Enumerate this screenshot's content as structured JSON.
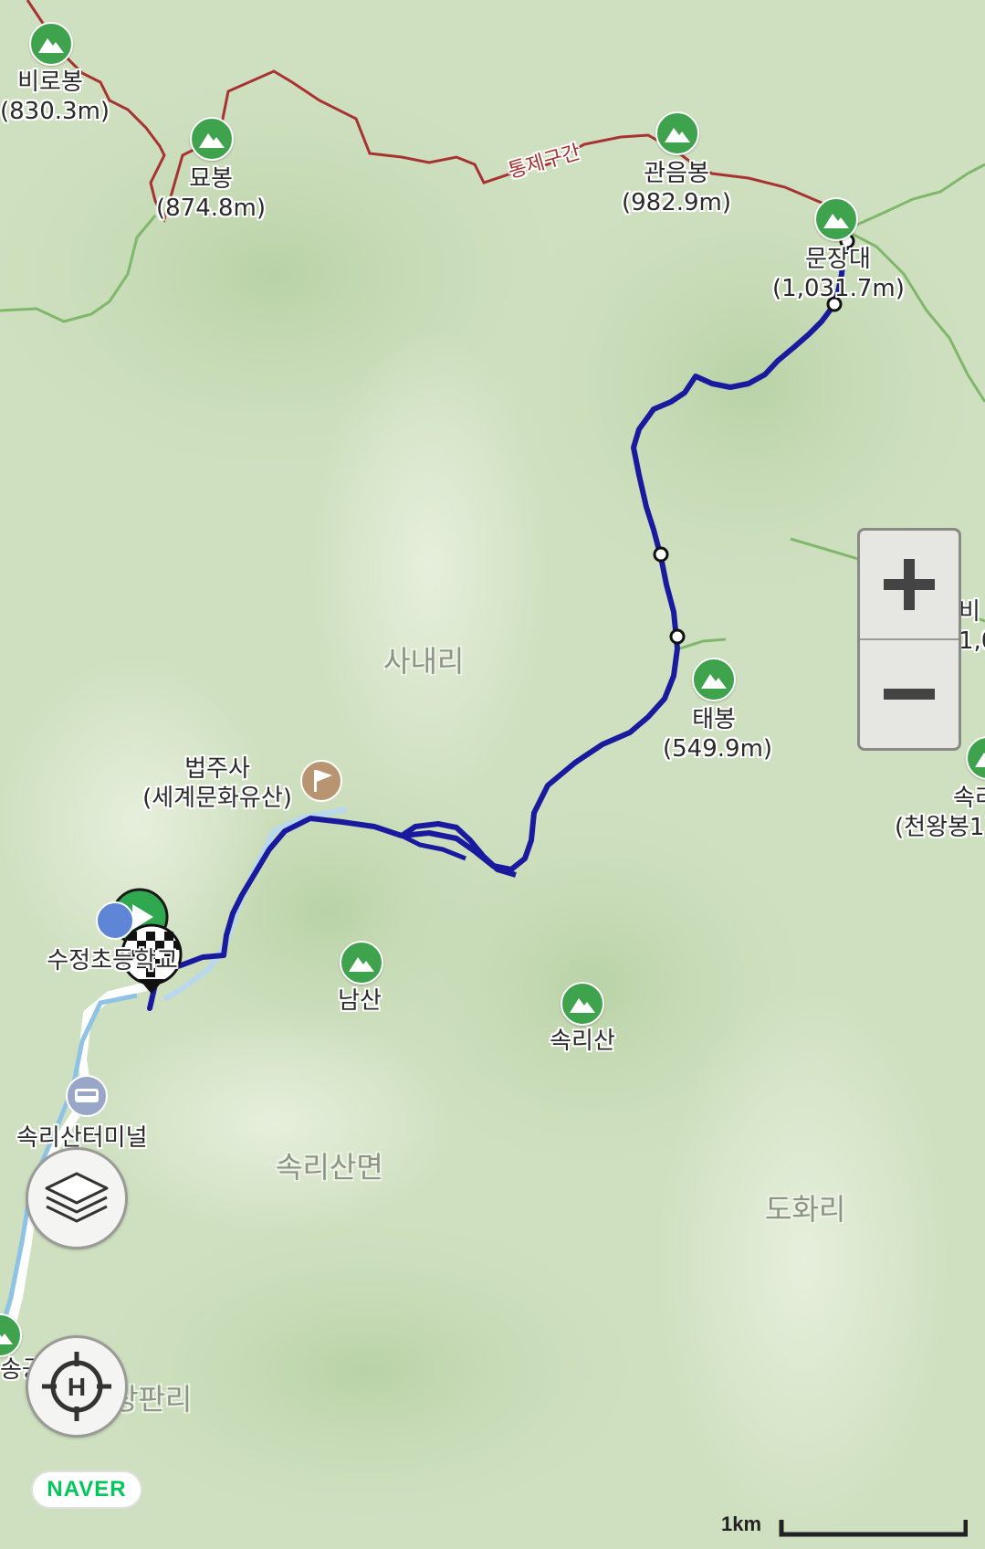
{
  "map": {
    "peaks": [
      {
        "name": "비로봉",
        "elevation": "(830.3m)"
      },
      {
        "name": "묘봉",
        "elevation": "(874.8m)"
      },
      {
        "name": "관음봉",
        "elevation": "(982.9m)"
      },
      {
        "name": "문장대",
        "elevation": "(1,031.7m)"
      },
      {
        "name": "태봉",
        "elevation": "(549.9m)"
      },
      {
        "name": "남산",
        "elevation": ""
      },
      {
        "name": "속리산",
        "elevation": ""
      },
      {
        "name": "속리",
        "elevation": "(천왕봉1"
      },
      {
        "name": "비",
        "elevation": "1,0"
      }
    ],
    "places": {
      "sanaeri": "사내리",
      "songnisanmyeon": "속리산면",
      "dohwari": "도화리",
      "sangpanri": "상판리",
      "beopjusa_name": "법주사",
      "beopjusa_sub": "(세계문화유산)",
      "sujeong": "수정초등학교",
      "terminal": "속리산터미널",
      "tongje": "통제구간",
      "songgong": "송공원"
    },
    "colors": {
      "track": "#1a1a9e",
      "peak": "#3fa34d",
      "restricted_trail": "#a83232",
      "trail": "#7fb86a",
      "background": "#cfe0c0"
    }
  },
  "controls": {
    "zoom_in_icon": "plus-icon",
    "zoom_out_icon": "minus-icon",
    "layers_icon": "layers-icon",
    "location_icon": "helipad-target-icon"
  },
  "brand": {
    "logo": "NAVER"
  },
  "scale": {
    "label": "1km"
  }
}
